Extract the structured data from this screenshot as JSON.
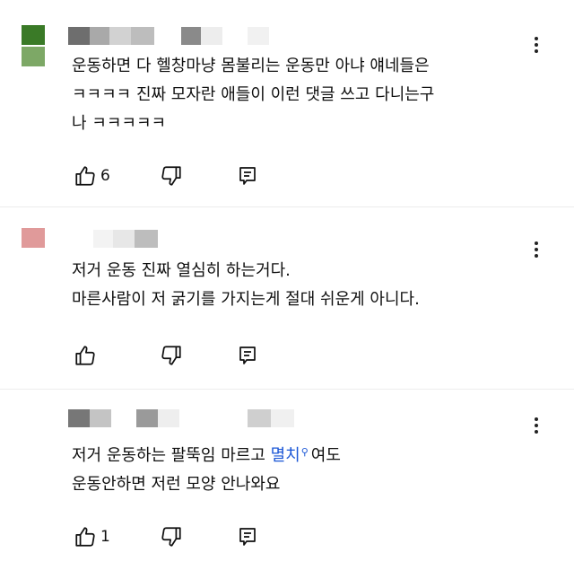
{
  "comments": [
    {
      "avatar_colors": [
        "#3a7a27",
        "#7da866"
      ],
      "lines": [
        "운동하면 다 헬창마냥 몸불리는 운동만 아냐 얘네들은",
        "ㅋㅋㅋㅋ 진짜 모자란 애들이 이런 댓글 쓰고 다니는구",
        "나 ㅋㅋㅋㅋㅋ"
      ],
      "likes": "6"
    },
    {
      "avatar_colors": [
        "#e09a9a",
        "#ffffff"
      ],
      "lines": [
        "저거 운동 진짜 열심히 하는거다.",
        "마른사람이 저 굵기를 가지는게 절대 쉬운게 아니다."
      ],
      "likes": ""
    },
    {
      "avatar_colors": [
        "#ffffff",
        "#ffffff"
      ],
      "line1_before": "저거 운동하는 팔뚝임 마르고 ",
      "line1_link": "멸치",
      "line1_after": "여도",
      "line2": "운동안하면 저런 모양 안나와요",
      "likes": "1"
    }
  ],
  "icons": {
    "like": "thumbs-up-icon",
    "dislike": "thumbs-down-icon",
    "reply": "reply-comment-icon",
    "more": "more-vertical-icon",
    "search": "search-icon"
  },
  "colors": {
    "hashtag": "#1a56d6"
  }
}
